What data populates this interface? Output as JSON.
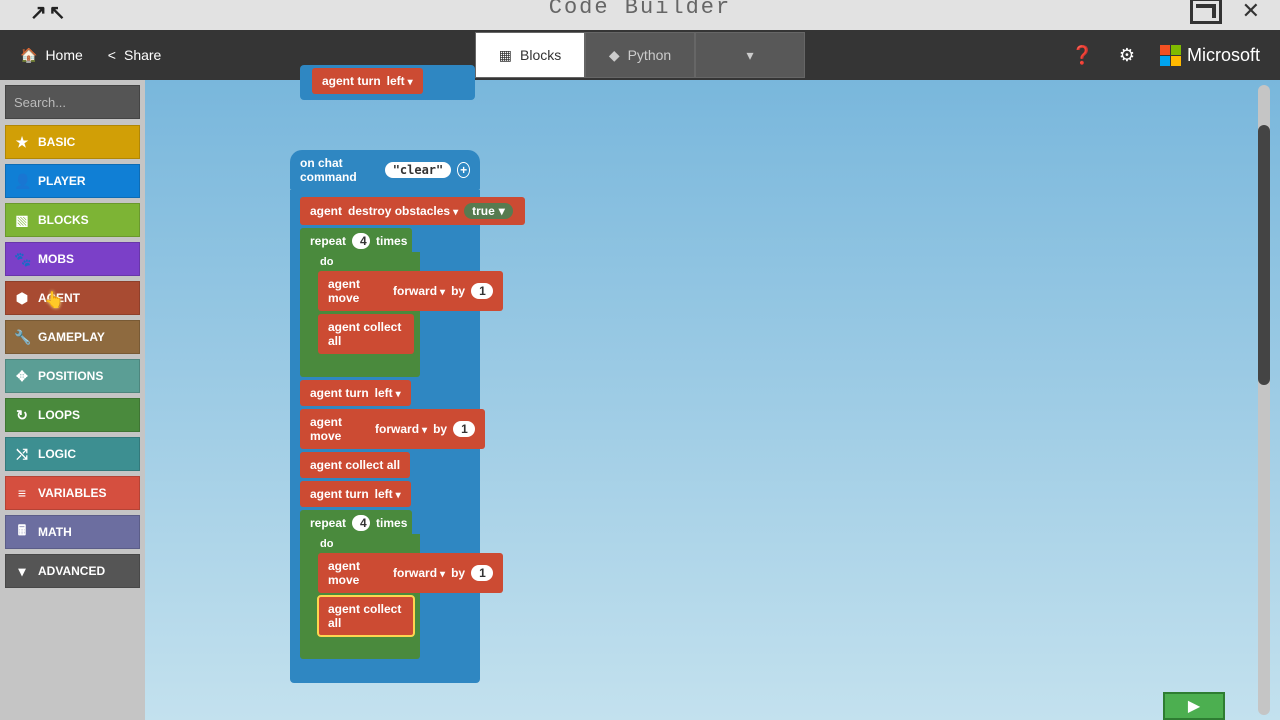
{
  "title": "Code Builder",
  "topbar": {
    "home": "Home",
    "share": "Share",
    "tab_blocks": "Blocks",
    "tab_python": "Python",
    "brand": "Microsoft"
  },
  "search": {
    "placeholder": "Search..."
  },
  "categories": [
    {
      "label": "BASIC",
      "icon": "★",
      "cls": "c-basic"
    },
    {
      "label": "PLAYER",
      "icon": "👤",
      "cls": "c-player"
    },
    {
      "label": "BLOCKS",
      "icon": "▧",
      "cls": "c-blocks"
    },
    {
      "label": "MOBS",
      "icon": "🐾",
      "cls": "c-mobs"
    },
    {
      "label": "AGENT",
      "icon": "⬢",
      "cls": "c-agent"
    },
    {
      "label": "GAMEPLAY",
      "icon": "🔧",
      "cls": "c-gameplay"
    },
    {
      "label": "POSITIONS",
      "icon": "✥",
      "cls": "c-positions"
    },
    {
      "label": "LOOPS",
      "icon": "↻",
      "cls": "c-loops"
    },
    {
      "label": "LOGIC",
      "icon": "⤭",
      "cls": "c-logic"
    },
    {
      "label": "VARIABLES",
      "icon": "≡",
      "cls": "c-variables"
    },
    {
      "label": "MATH",
      "icon": "🖩",
      "cls": "c-math"
    },
    {
      "label": "ADVANCED",
      "icon": "❱",
      "cls": "c-advanced"
    }
  ],
  "blocks": {
    "top_block": {
      "label": "agent turn",
      "dir": "left"
    },
    "chat_cmd": {
      "label": "on chat command",
      "value": "\"clear\""
    },
    "destroy": {
      "label": "agent",
      "opt": "destroy obstacles",
      "val": "true"
    },
    "repeat1": {
      "label": "repeat",
      "times": "4",
      "suffix": "times"
    },
    "do": "do",
    "move1": {
      "label": "agent move",
      "dir": "forward",
      "by": "by",
      "n": "1"
    },
    "collect": "agent collect all",
    "turn1": {
      "label": "agent turn",
      "dir": "left"
    },
    "move2": {
      "label": "agent move",
      "dir": "forward",
      "by": "by",
      "n": "1"
    },
    "repeat2": {
      "label": "repeat",
      "times": "4",
      "suffix": "times"
    },
    "move3": {
      "label": "agent move",
      "dir": "forward",
      "by": "by",
      "n": "1"
    }
  }
}
